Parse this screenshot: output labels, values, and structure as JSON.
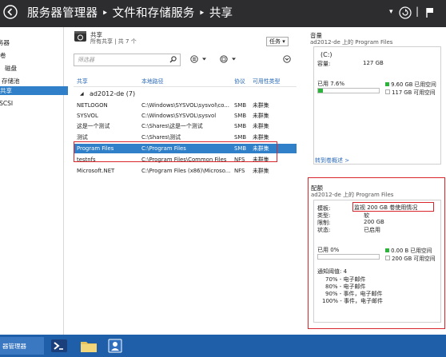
{
  "titlebar": {
    "title": "服务器管理器 ‣ 文件和存储服务 ‣ 共享",
    "back_icon": "back-arrow-icon",
    "dropdown_glyph": "▾",
    "refresh_glyph": "⟳",
    "separator_glyph": "|",
    "flag_glyph": "▌"
  },
  "nav": {
    "items": [
      {
        "label": "务器",
        "selected": false
      },
      {
        "label": "卷",
        "selected": false
      },
      {
        "label": "磁盘",
        "selected": false
      },
      {
        "label": "存储池",
        "selected": false
      },
      {
        "label": "共享",
        "selected": true
      },
      {
        "label": "iSCSI",
        "selected": false
      }
    ]
  },
  "shares": {
    "title": "共享",
    "subtitle": "所有共享 | 共 7 个",
    "task_label": "任务",
    "filter_placeholder": "筛选器",
    "columns": [
      "共享",
      "本地路径",
      "协议",
      "可用性类型"
    ],
    "group_label": "ad2012-de (7)",
    "rows": [
      {
        "name": "NETLOGON",
        "path": "C:\\Windows\\SYSVOL\\sysvol\\co...",
        "protocol": "SMB",
        "type": "未群集"
      },
      {
        "name": "SYSVOL",
        "path": "C:\\Windows\\SYSVOL\\sysvol",
        "protocol": "SMB",
        "type": "未群集"
      },
      {
        "name": "这是一个测试",
        "path": "C:\\Shares\\这是一个测试",
        "protocol": "SMB",
        "type": "未群集"
      },
      {
        "name": "测试",
        "path": "C:\\Shares\\测试",
        "protocol": "SMB",
        "type": "未群集"
      },
      {
        "name": "Program Files",
        "path": "C:\\Program Files",
        "protocol": "SMB",
        "type": "未群集",
        "selected": true
      },
      {
        "name": "testnfs",
        "path": "C:\\Program Files\\Common Files",
        "protocol": "NFS",
        "type": "未群集"
      },
      {
        "name": "Microsoft.NET",
        "path": "C:\\Program Files (x86)\\Microso...",
        "protocol": "NFS",
        "type": "未群集"
      }
    ]
  },
  "volume": {
    "title": "音量",
    "subtitle": "ad2012-de 上的 Program Files",
    "drive": "(C:)",
    "capacity_label": "容量:",
    "capacity_value": "127 GB",
    "used_label": "已用 7.6%",
    "used_fraction": 0.076,
    "used_space": "9.60 GB 已用空间",
    "free_space": "117 GB 可用空间",
    "link": "转到卷概述 >",
    "used_color": "#2bb33c"
  },
  "quota": {
    "title": "配额",
    "subtitle": "ad2012-de 上的 Program Files",
    "template_label": "模板:",
    "template_value": "监视 200 GB 卷使用情况",
    "type_label": "类型:",
    "type_value": "软",
    "limit_label": "限制:",
    "limit_value": "200 GB",
    "status_label": "状态:",
    "status_value": "已启用",
    "used_label": "已用 0%",
    "used_fraction": 0,
    "used_space": "0.00 B 已用空间",
    "free_space": "200 GB 可用空间",
    "thresholds_title": "通知阈值: 4",
    "thresholds": [
      "70% - 电子邮件",
      "80% - 电子邮件",
      "90% - 事件，电子邮件",
      "100% - 事件，电子邮件"
    ]
  },
  "taskbar": {
    "label": "器管理器",
    "background": "#1f5ea9"
  },
  "colors": {
    "selection": "#2f80c8",
    "highlight_border": "#d9262d",
    "header_text": "#2c6bb8"
  }
}
